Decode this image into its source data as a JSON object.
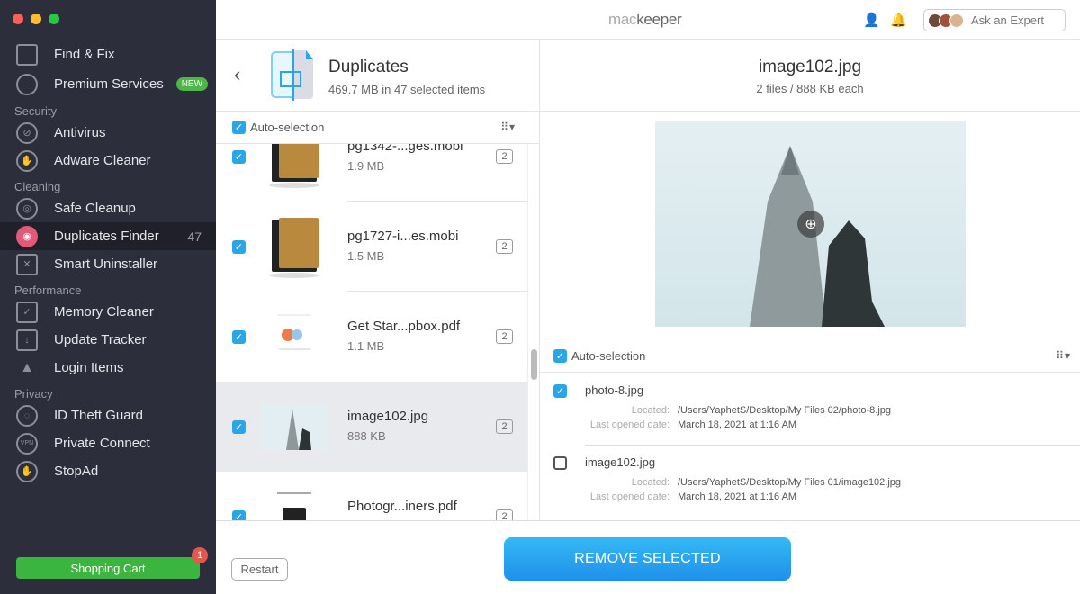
{
  "app": {
    "logo_prefix": "mac",
    "logo_suffix": "keeper",
    "ask_expert": "Ask an Expert"
  },
  "sidebar": {
    "items": [
      {
        "label": "Find & Fix",
        "icon": "monitor-icon"
      },
      {
        "label": "Premium Services",
        "icon": "headset-icon",
        "badge": "NEW"
      },
      {
        "label": "Antivirus",
        "icon": "no-bug-icon"
      },
      {
        "label": "Adware Cleaner",
        "icon": "hand-icon"
      },
      {
        "label": "Safe Cleanup",
        "icon": "disc-icon"
      },
      {
        "label": "Duplicates Finder",
        "icon": "duplicates-icon",
        "count": "47"
      },
      {
        "label": "Smart Uninstaller",
        "icon": "trash-icon"
      },
      {
        "label": "Memory Cleaner",
        "icon": "checklist-icon"
      },
      {
        "label": "Update Tracker",
        "icon": "update-icon"
      },
      {
        "label": "Login Items",
        "icon": "rocket-icon"
      },
      {
        "label": "ID Theft Guard",
        "icon": "fingerprint-icon"
      },
      {
        "label": "Private Connect",
        "icon": "vpn-shield-icon"
      },
      {
        "label": "StopAd",
        "icon": "hand-stop-icon"
      }
    ],
    "sections": [
      "Security",
      "Cleaning",
      "Performance",
      "Privacy"
    ],
    "cart": {
      "label": "Shopping Cart",
      "badge": "1"
    }
  },
  "left": {
    "title": "Duplicates",
    "subtitle": "469.7 MB in 47 selected items",
    "auto_selection": "Auto-selection",
    "files": [
      {
        "name": "pg1342-...ges.mobi",
        "size": "1.9 MB",
        "count": "2",
        "checked": true
      },
      {
        "name": "pg1727-i...es.mobi",
        "size": "1.5 MB",
        "count": "2",
        "checked": true
      },
      {
        "name": "Get Star...pbox.pdf",
        "size": "1.1 MB",
        "count": "2",
        "checked": true
      },
      {
        "name": "image102.jpg",
        "size": "888 KB",
        "count": "2",
        "checked": true,
        "selected": true
      },
      {
        "name": "Photogr...iners.pdf",
        "size": "",
        "count": "2",
        "checked": true
      }
    ]
  },
  "right": {
    "title": "image102.jpg",
    "subtitle": "2 files / 888 KB each",
    "auto_selection": "Auto-selection",
    "located_label": "Located:",
    "opened_label": "Last opened date:",
    "duplicates": [
      {
        "name": "photo-8.jpg",
        "path": "/Users/YaphetS/Desktop/My Files 02/photo-8.jpg",
        "date": "March 18, 2021 at 1:16 AM",
        "checked": true
      },
      {
        "name": "image102.jpg",
        "path": "/Users/YaphetS/Desktop/My Files 01/image102.jpg",
        "date": "March 18, 2021 at 1:16 AM",
        "checked": false
      }
    ]
  },
  "footer": {
    "restart": "Restart",
    "remove": "REMOVE SELECTED"
  },
  "colors": {
    "accent": "#2aa6e8",
    "sidebar": "#2c2e3b",
    "cart": "#3cb540"
  }
}
